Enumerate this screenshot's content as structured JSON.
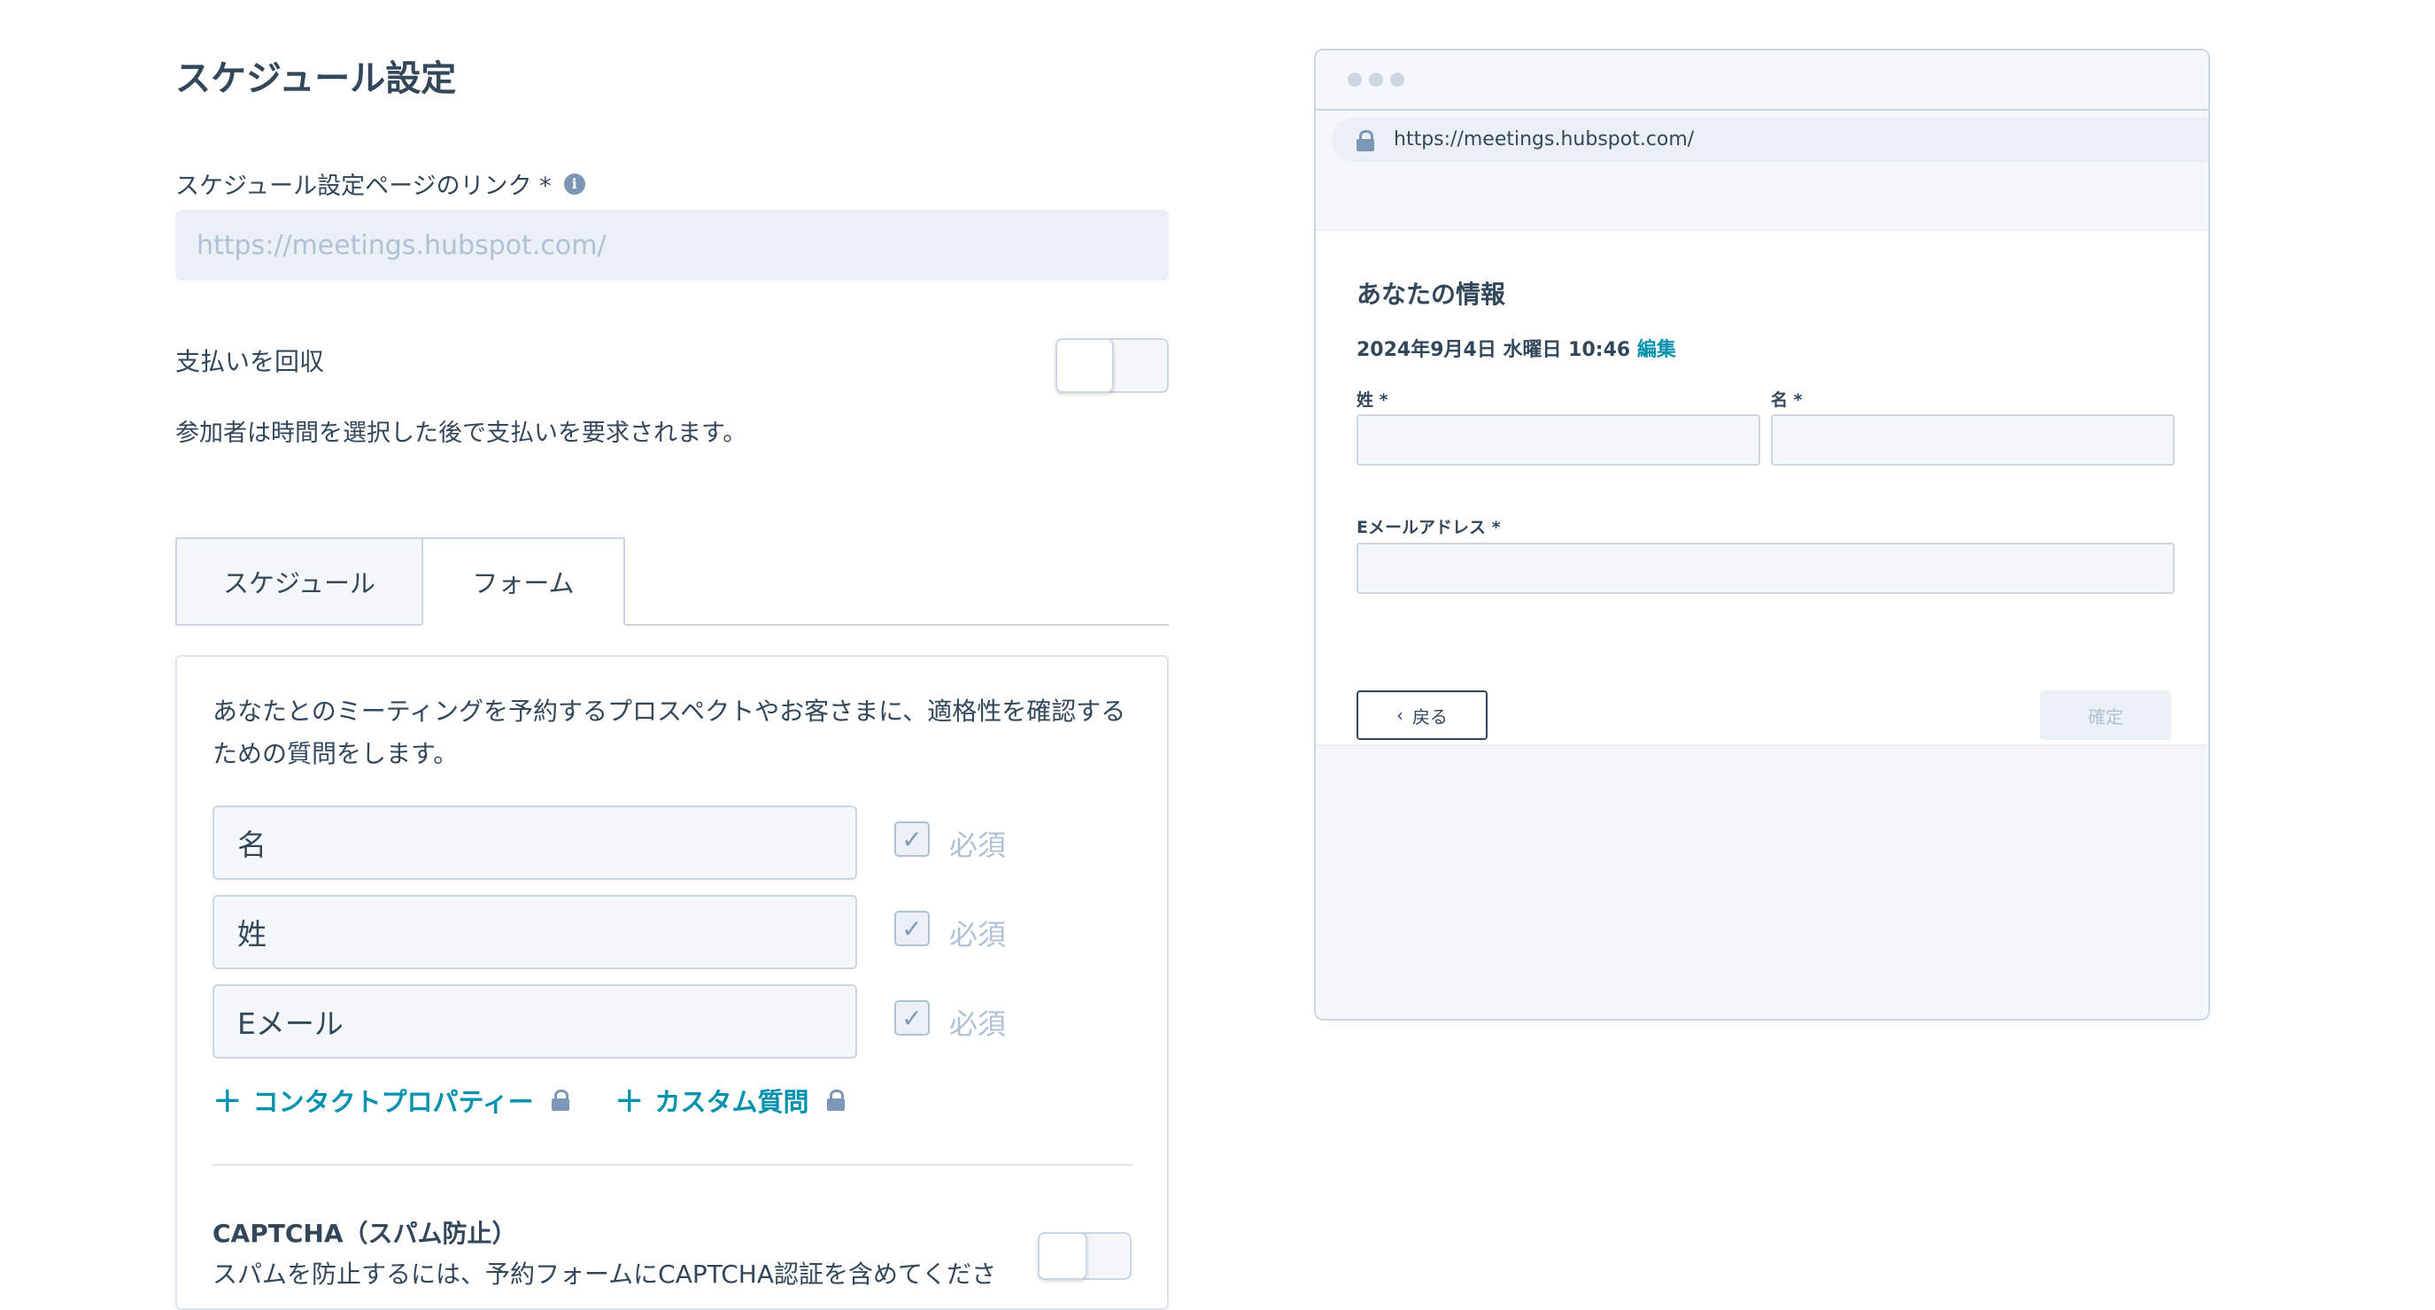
{
  "settings": {
    "title": "スケジュール設定",
    "link_label": "スケジュール設定ページのリンク *",
    "link_placeholder": "https://meetings.hubspot.com/",
    "payment_label": "支払いを回収",
    "payment_desc": "参加者は時間を選択した後で支払いを要求されます。"
  },
  "tabs": [
    {
      "label": "スケジュール"
    },
    {
      "label": "フォーム"
    }
  ],
  "form": {
    "description": "あなたとのミーティングを予約するプロスペクトやお客さまに、適格性を確認するための質問をします。",
    "fields": [
      {
        "label": "名",
        "required_label": "必須",
        "required": true
      },
      {
        "label": "姓",
        "required_label": "必須",
        "required": true
      },
      {
        "label": "Eメール",
        "required_label": "必須",
        "required": true
      }
    ],
    "add_contact_property": "コンタクトプロパティー",
    "add_custom_question": "カスタム質問",
    "captcha_title": "CAPTCHA（スパム防止）",
    "captcha_desc": "スパムを防止するには、予約フォームにCAPTCHA認証を含めてくださ"
  },
  "preview": {
    "url": "https://meetings.hubspot.com/",
    "card_title": "あなたの情報",
    "datetime": "2024年9月4日 水曜日 10:46",
    "edit_link": "編集",
    "last_name_label": "姓 *",
    "first_name_label": "名 *",
    "email_label": "Eメールアドレス *",
    "back_button": "戻る",
    "confirm_button": "確定"
  },
  "colors": {
    "text": "#33475b",
    "link": "#0091ae",
    "muted": "#b0c1d4",
    "border": "#cbd6e2",
    "field_bg": "#f5f8fa"
  }
}
